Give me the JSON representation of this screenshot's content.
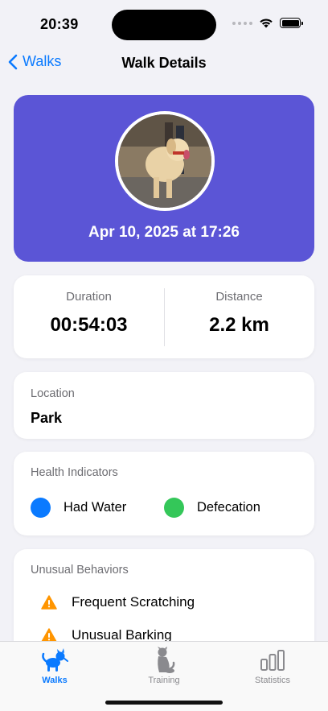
{
  "status_bar": {
    "time": "20:39"
  },
  "nav": {
    "back_label": "Walks",
    "title": "Walk Details"
  },
  "hero": {
    "date_time": "Apr 10, 2025 at 17:26",
    "accent_color": "#5b55d6"
  },
  "stats": {
    "duration_label": "Duration",
    "duration_value": "00:54:03",
    "distance_label": "Distance",
    "distance_value": "2.2 km"
  },
  "location": {
    "label": "Location",
    "value": "Park"
  },
  "health": {
    "label": "Health Indicators",
    "indicators": [
      {
        "label": "Had Water",
        "color": "#0a7aff"
      },
      {
        "label": "Defecation",
        "color": "#34c759"
      }
    ]
  },
  "unusual": {
    "label": "Unusual Behaviors",
    "items": [
      {
        "label": "Frequent Scratching",
        "icon": "warning-icon"
      },
      {
        "label": "Unusual Barking",
        "icon": "warning-icon"
      }
    ]
  },
  "tabs": [
    {
      "label": "Walks",
      "icon": "dog-walk-icon",
      "active": true
    },
    {
      "label": "Training",
      "icon": "dog-sitting-icon",
      "active": false
    },
    {
      "label": "Statistics",
      "icon": "bar-chart-icon",
      "active": false
    }
  ]
}
